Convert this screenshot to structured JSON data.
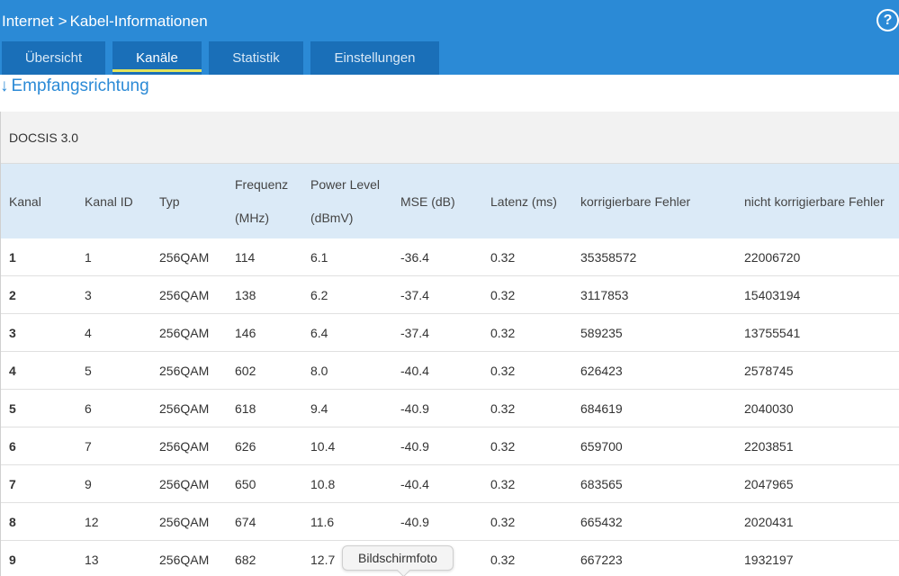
{
  "header": {
    "breadcrumb_root": "Internet",
    "breadcrumb_separator": ">",
    "breadcrumb_current": "Kabel-Informationen",
    "help_label": "?"
  },
  "tabs": [
    {
      "label": "Übersicht",
      "active": false
    },
    {
      "label": "Kanäle",
      "active": true
    },
    {
      "label": "Statistik",
      "active": false
    },
    {
      "label": "Einstellungen",
      "active": false
    }
  ],
  "section": {
    "arrow": "↓",
    "title": "Empfangsrichtung"
  },
  "docsis_label": "DOCSIS 3.0",
  "table": {
    "headers": {
      "kanal": "Kanal",
      "kanal_id": "Kanal ID",
      "typ": "Typ",
      "frequenz_1": "Frequenz",
      "frequenz_2": "(MHz)",
      "power_1": "Power Level",
      "power_2": "(dBmV)",
      "mse": "MSE (dB)",
      "latenz": "Latenz (ms)",
      "korr": "korrigierbare Fehler",
      "nichtkorr": "nicht korrigierbare Fehler"
    },
    "rows": [
      {
        "kanal": "1",
        "id": "1",
        "typ": "256QAM",
        "freq": "114",
        "power": "6.1",
        "mse": "-36.4",
        "lat": "0.32",
        "korr": "35358572",
        "nkorr": "22006720"
      },
      {
        "kanal": "2",
        "id": "3",
        "typ": "256QAM",
        "freq": "138",
        "power": "6.2",
        "mse": "-37.4",
        "lat": "0.32",
        "korr": "3117853",
        "nkorr": "15403194"
      },
      {
        "kanal": "3",
        "id": "4",
        "typ": "256QAM",
        "freq": "146",
        "power": "6.4",
        "mse": "-37.4",
        "lat": "0.32",
        "korr": "589235",
        "nkorr": "13755541"
      },
      {
        "kanal": "4",
        "id": "5",
        "typ": "256QAM",
        "freq": "602",
        "power": "8.0",
        "mse": "-40.4",
        "lat": "0.32",
        "korr": "626423",
        "nkorr": "2578745"
      },
      {
        "kanal": "5",
        "id": "6",
        "typ": "256QAM",
        "freq": "618",
        "power": "9.4",
        "mse": "-40.9",
        "lat": "0.32",
        "korr": "684619",
        "nkorr": "2040030"
      },
      {
        "kanal": "6",
        "id": "7",
        "typ": "256QAM",
        "freq": "626",
        "power": "10.4",
        "mse": "-40.9",
        "lat": "0.32",
        "korr": "659700",
        "nkorr": "2203851"
      },
      {
        "kanal": "7",
        "id": "9",
        "typ": "256QAM",
        "freq": "650",
        "power": "10.8",
        "mse": "-40.4",
        "lat": "0.32",
        "korr": "683565",
        "nkorr": "2047965"
      },
      {
        "kanal": "8",
        "id": "12",
        "typ": "256QAM",
        "freq": "674",
        "power": "11.6",
        "mse": "-40.9",
        "lat": "0.32",
        "korr": "665432",
        "nkorr": "2020431"
      },
      {
        "kanal": "9",
        "id": "13",
        "typ": "256QAM",
        "freq": "682",
        "power": "12.7",
        "mse": "",
        "lat": "0.32",
        "korr": "667223",
        "nkorr": "1932197"
      }
    ]
  },
  "tooltip": "Bildschirmfoto",
  "colors": {
    "header_bg": "#2b8ad6",
    "tab_bg": "#1a6fb8",
    "active_tab_underline": "#e3e35a",
    "table_header_bg": "#dbeaf7"
  }
}
